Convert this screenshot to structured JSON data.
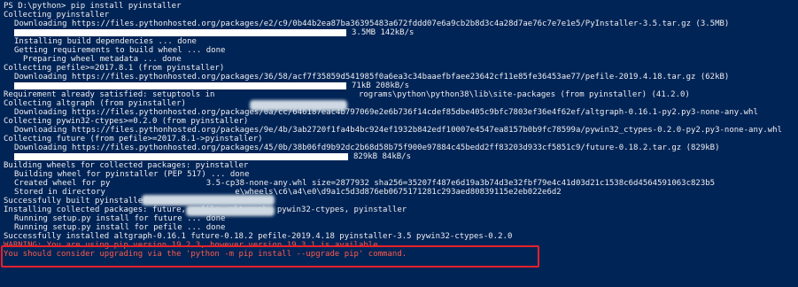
{
  "terminal": {
    "lines": [
      {
        "type": "text",
        "text": "PS D:\\python> pip install pyinstaller"
      },
      {
        "type": "text",
        "text": "Collecting pyinstaller"
      },
      {
        "type": "text",
        "indent": 1,
        "text": "Downloading https://files.pythonhosted.org/packages/e2/c9/0b44b2ea87ba36395483a672fddd07e6a9cb2b8d3c4a28d7ae76c7e7e1e5/PyInstaller-3.5.tar.gz (3.5MB)"
      },
      {
        "type": "progress",
        "text": "3.5MB 142kB/s",
        "percent": 100
      },
      {
        "type": "text",
        "indent": 1,
        "text": "Installing build dependencies ... done"
      },
      {
        "type": "text",
        "indent": 1,
        "text": "Getting requirements to build wheel ... done"
      },
      {
        "type": "text",
        "indent": 2,
        "text": "Preparing wheel metadata ... done"
      },
      {
        "type": "text",
        "text": "Collecting pefile>=2017.8.1 (from pyinstaller)"
      },
      {
        "type": "text",
        "indent": 1,
        "text": "Downloading https://files.pythonhosted.org/packages/36/58/acf7f35859d541985f0a6ea3c34baaefbfaee23642cf11e85fe36453ae77/pefile-2019.4.18.tar.gz (62kB)"
      },
      {
        "type": "progress",
        "text": "71kB 208kB/s",
        "percent": 100
      },
      {
        "type": "text",
        "text": "Requirement already satisfied: setuptools in                              rograms\\python\\python38\\lib\\site-packages (from pyinstaller) (41.2.0)"
      },
      {
        "type": "text",
        "text": "Collecting altgraph (from pyinstaller)"
      },
      {
        "type": "text",
        "indent": 1,
        "text": "Downloading https://files.pythonhosted.org/packages/0a/cc/646187eac4b797069e2e6b736f14cdef85dbe405c9bfc7803ef36e4f62ef/altgraph-0.16.1-py2.py3-none-any.whl"
      },
      {
        "type": "text",
        "text": "Collecting pywin32-ctypes>=0.2.0 (from pyinstaller)"
      },
      {
        "type": "text",
        "indent": 1,
        "text": "Downloading https://files.pythonhosted.org/packages/9e/4b/3ab2720f1fa4b4bc924ef1932b842edf10007e4547ea8157b0b9fc78599a/pywin32_ctypes-0.2.0-py2.py3-none-any.whl"
      },
      {
        "type": "text",
        "text": "Collecting future (from pefile>=2017.8.1->pyinstaller)"
      },
      {
        "type": "text",
        "indent": 1,
        "text": "Downloading https://files.pythonhosted.org/packages/45/0b/38b06fd9b92dc2b68d58b75f900e97884c45bedd2ff83203d933cf5851c9/future-0.18.2.tar.gz (829kB)"
      },
      {
        "type": "progress",
        "text": "829kB 84kB/s",
        "percent": 100,
        "wide": true
      },
      {
        "type": "text",
        "text": "Building wheels for collected packages: pyinstaller"
      },
      {
        "type": "text",
        "indent": 1,
        "text": "Building wheel for pyinstaller (PEP 517) ... done"
      },
      {
        "type": "text",
        "indent": 1,
        "text": "Created wheel for py                    3.5-cp38-none-any.whl size=2877932 sha256=35207f487e6d19a3b74d3e32fbf79e4c41d03d21c1538c6d4564591063c823b5"
      },
      {
        "type": "text",
        "indent": 1,
        "text": "Stored in directory                           e\\wheels\\c6\\a4\\e0\\d9a1c5d3d876eb0675171281c293aed80839115e2eb022e6d2"
      },
      {
        "type": "text",
        "text": "Successfully built pyinstaller"
      },
      {
        "type": "text",
        "text": "Installing collected packages: future, pefile, altgraph, pywin32-ctypes, pyinstaller"
      },
      {
        "type": "text",
        "indent": 1,
        "text": "Running setup.py install for future ... done"
      },
      {
        "type": "text",
        "indent": 1,
        "text": "Running setup.py install for pefile ... done"
      },
      {
        "type": "text",
        "text": "Successfully installed altgraph-0.16.1 future-0.18.2 pefile-2019.4.18 pyinstaller-3.5 pywin32-ctypes-0.2.0"
      },
      {
        "type": "warn",
        "text": "WARNING: You are using pip version 19.2.3, however version 19.3.1 is available."
      },
      {
        "type": "warn",
        "text": "You should consider upgrading via the 'python -m pip install --upgrade pip' command."
      }
    ]
  },
  "colors": {
    "background": "#012456",
    "text": "#eeedf0",
    "warning": "#ff5a4a",
    "highlight_border": "#e8202a"
  }
}
